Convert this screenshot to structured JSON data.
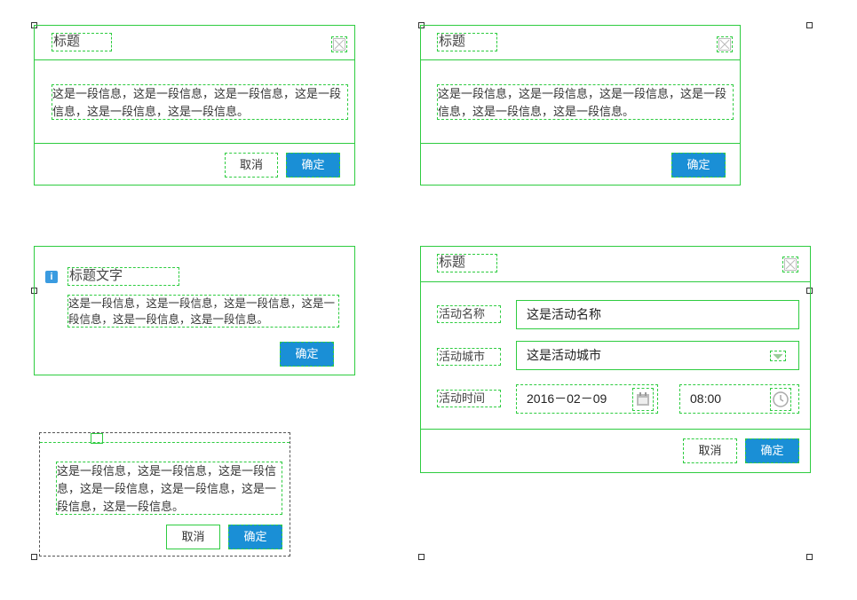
{
  "dialog1": {
    "title": "标题",
    "body": "这是一段信息，这是一段信息，这是一段信息，这是一段信息，这是一段信息，这是一段信息。",
    "cancel": "取消",
    "ok": "确定"
  },
  "dialog2": {
    "title": "标题",
    "body": "这是一段信息，这是一段信息，这是一段信息，这是一段信息，这是一段信息，这是一段信息。",
    "ok": "确定"
  },
  "dialog3": {
    "title": "标题文字",
    "body": "这是一段信息，这是一段信息，这是一段信息，这是一段信息，这是一段信息，这是一段信息。",
    "ok": "确定",
    "icon": "info-icon"
  },
  "dialog4": {
    "body": "这是一段信息，这是一段信息，这是一段信息，这是一段信息，这是一段信息，这是一段信息，这是一段信息。",
    "cancel": "取消",
    "ok": "确定"
  },
  "form_dialog": {
    "title": "标题",
    "fields": [
      {
        "label": "活动名称",
        "value": "这是活动名称"
      },
      {
        "label": "活动城市",
        "value": "这是活动城市"
      },
      {
        "label": "活动时间",
        "date": "2016－02－09",
        "time": "08:00"
      }
    ],
    "cancel": "取消",
    "ok": "确定"
  },
  "colors": {
    "primary": "#1a8fd6",
    "annotation": "#2ecc40"
  }
}
